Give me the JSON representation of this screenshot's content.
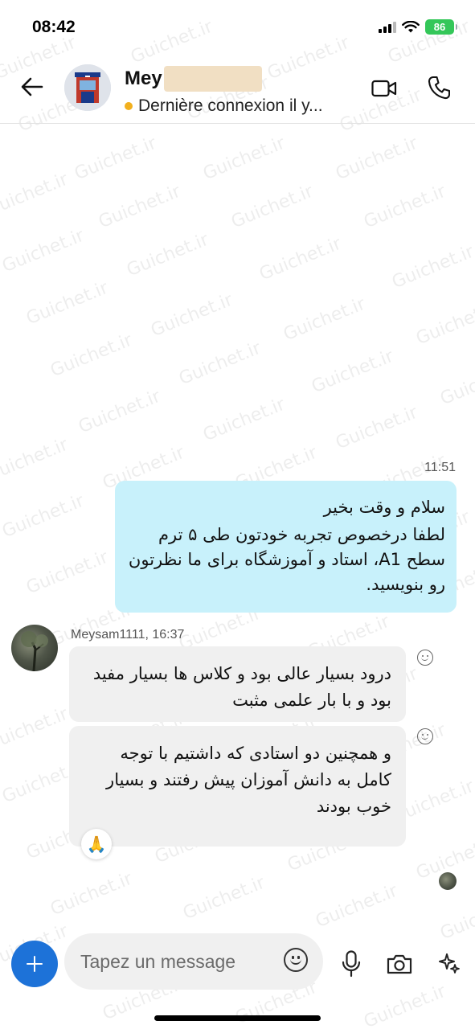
{
  "status_bar": {
    "time": "08:42",
    "battery": "86"
  },
  "header": {
    "contact_name": "Mey",
    "presence": "Dernière connexion il y...",
    "presence_color": "#f2b01e"
  },
  "conversation": {
    "outgoing": {
      "time": "11:51",
      "line1": "سلام و وقت بخیر",
      "line2": "لطفا درخصوص تجربه خودتون طی ۵ ترم سطح A1، استاد و آموزشگاه برای ما نظرتون رو بنویسید.",
      "bubble_color": "#c8f1fb"
    },
    "incoming": {
      "sender": "Meysam1111, 16:37",
      "messages": [
        {
          "text": "درود بسیار عالی بود و کلاس ها بسیار مفید بود و با بار علمی مثبت"
        },
        {
          "text": "و همچنین دو استادی که داشتیم با توجه کامل به دانش آموزان پیش رفتند و بسیار خوب بودند",
          "reaction": "🙏"
        }
      ]
    }
  },
  "composer": {
    "placeholder": "Tapez un message",
    "accent_color": "#1d72d8"
  },
  "watermark": "Guichet.ir",
  "icons": [
    "back-arrow-icon",
    "video-call-icon",
    "phone-icon",
    "plus-icon",
    "emoji-icon",
    "microphone-icon",
    "camera-icon",
    "sparkle-icon",
    "smiley-reaction-icon",
    "folded-hands-icon"
  ]
}
